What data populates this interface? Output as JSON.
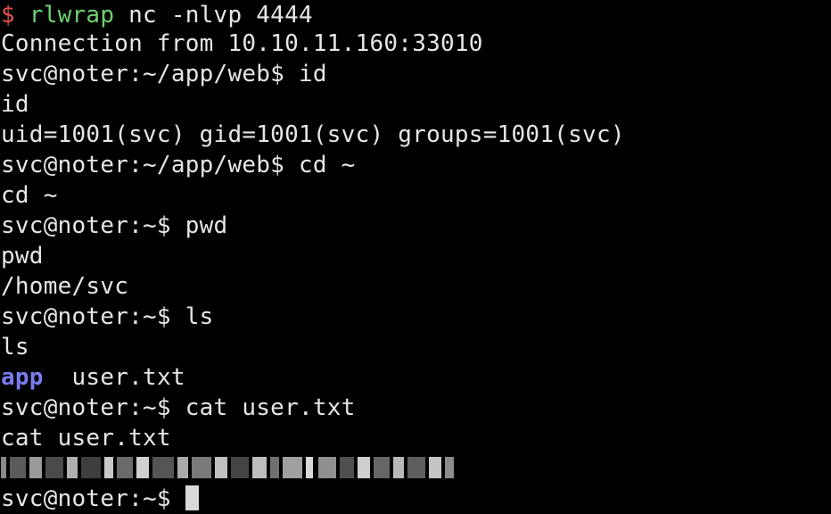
{
  "terminal": {
    "listener": {
      "prompt_symbol": "$",
      "command_name": "rlwrap",
      "command_args": " nc -nlvp 4444"
    },
    "lines": [
      "Connection from 10.10.11.160:33010",
      "svc@noter:~/app/web$ id",
      "id",
      "uid=1001(svc) gid=1001(svc) groups=1001(svc)",
      "svc@noter:~/app/web$ cd ~",
      "cd ~",
      "svc@noter:~$ pwd",
      "pwd",
      "/home/svc",
      "svc@noter:~$ ls",
      "ls"
    ],
    "ls_output": {
      "directory": "app",
      "separator": "  ",
      "file": "user.txt"
    },
    "lines_after": [
      "svc@noter:~$ cat user.txt",
      "cat user.txt"
    ],
    "redacted_flag_description": "pixelated user flag",
    "final_prompt": "svc@noter:~$ ",
    "colors": {
      "background": "#000000",
      "text": "#e6e6e6",
      "prompt_symbol": "#e4514f",
      "listener_command": "#6fd16f",
      "directory": "#7a7cf0",
      "cursor": "#d9d9d9"
    }
  }
}
